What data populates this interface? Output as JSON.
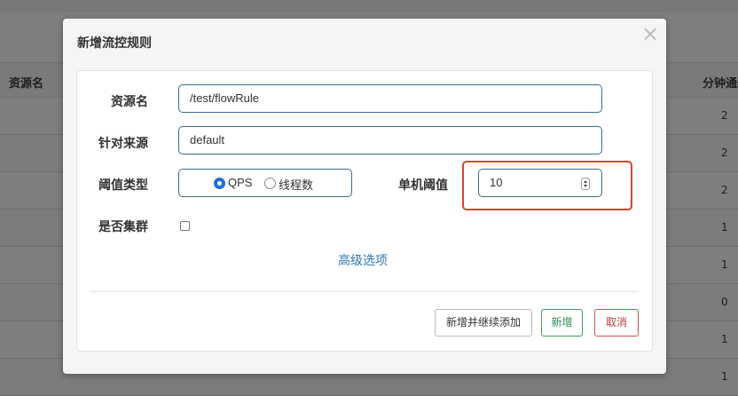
{
  "background": {
    "header_left": "资源名",
    "header_right": "分钟通过",
    "row_values": [
      "2",
      "2",
      "2",
      "1",
      "1",
      "0",
      "1",
      "1"
    ]
  },
  "modal": {
    "title": "新增流控规则",
    "close_icon": "×",
    "form": {
      "resource_label": "资源名",
      "resource_value": "/test/flowRule",
      "limit_app_label": "针对来源",
      "limit_app_value": "default",
      "threshold_type_label": "阈值类型",
      "threshold_options": [
        "QPS",
        "线程数"
      ],
      "threshold_selected": "QPS",
      "single_threshold_label": "单机阈值",
      "single_threshold_value": "10",
      "cluster_label": "是否集群",
      "cluster_checked": false,
      "advanced_link": "高级选项"
    },
    "buttons": {
      "save_continue": "新增并继续添加",
      "save": "新增",
      "cancel": "取消"
    }
  },
  "colors": {
    "input_border": "#3a6b8a",
    "highlight_frame": "#e0402a",
    "save_green": "#2e8b4e",
    "cancel_red": "#c03a3a",
    "link_blue": "#2b7ab5"
  }
}
